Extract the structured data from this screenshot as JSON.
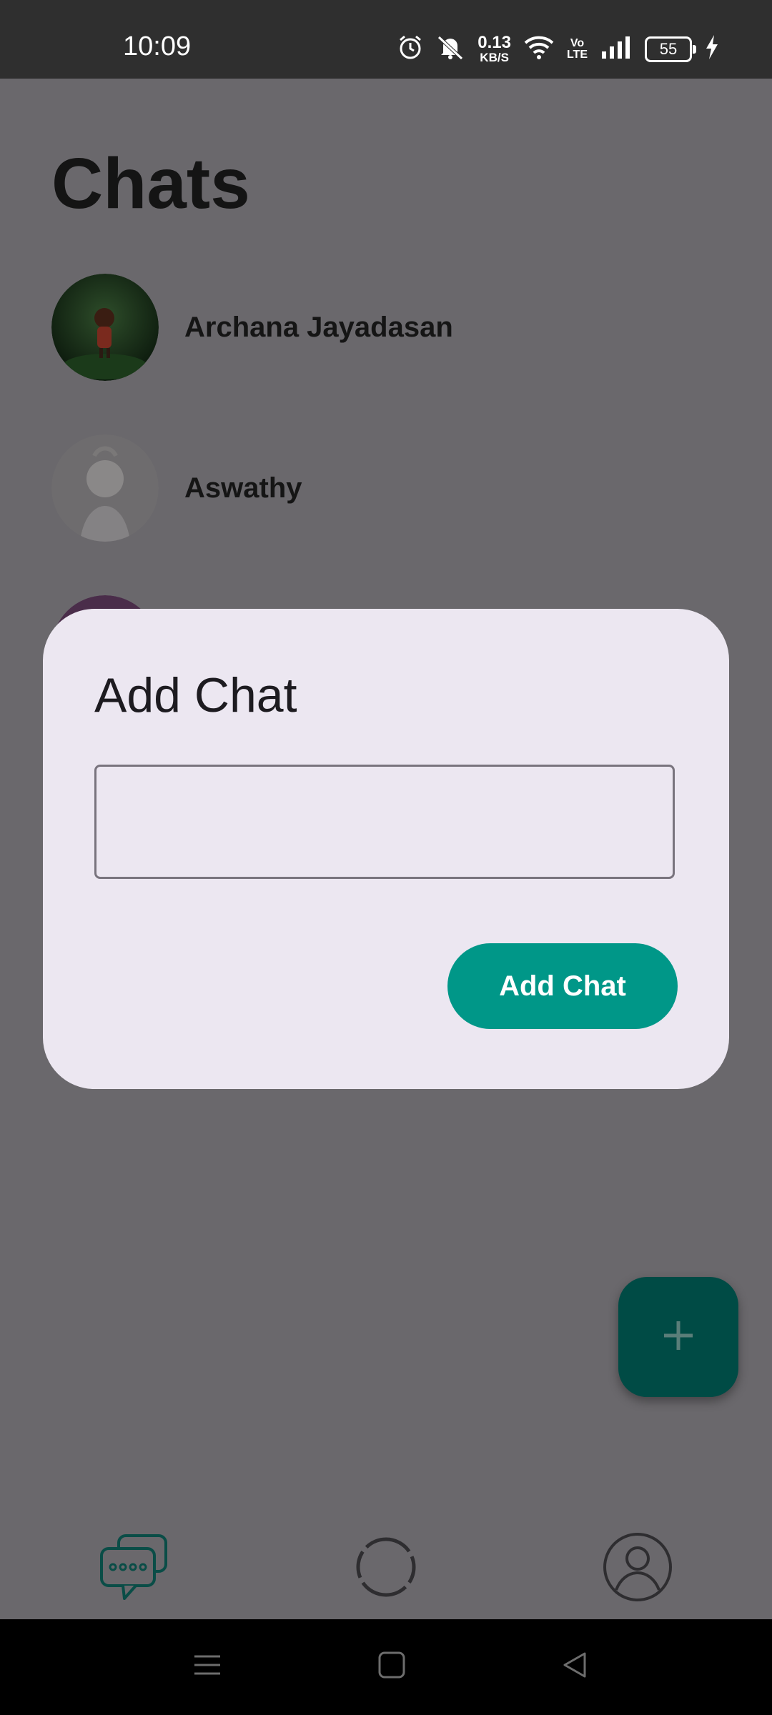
{
  "status_bar": {
    "time": "10:09",
    "net_speed_value": "0.13",
    "net_speed_unit": "KB/S",
    "volte_top": "Vo",
    "volte_bottom": "LTE",
    "battery_level": "55",
    "icons": [
      "alarm-icon",
      "mute-icon",
      "wifi-icon",
      "signal-icon",
      "battery-icon",
      "charging-icon"
    ]
  },
  "page": {
    "title": "Chats"
  },
  "chats": [
    {
      "name": "Archana Jayadasan"
    },
    {
      "name": "Aswathy"
    }
  ],
  "dialog": {
    "title": "Add Chat",
    "input_value": "",
    "input_placeholder": "",
    "button_label": "Add Chat"
  },
  "fab": {
    "icon": "plus-icon"
  },
  "bottom_nav": {
    "items": [
      {
        "icon": "chats-icon",
        "active": true
      },
      {
        "icon": "status-icon",
        "active": false
      },
      {
        "icon": "profile-icon",
        "active": false
      }
    ]
  },
  "system_nav": {
    "items": [
      "menu-icon",
      "home-icon",
      "back-icon"
    ]
  },
  "colors": {
    "accent": "#009788",
    "fab": "#004b45",
    "dialog_bg": "#ece7f1",
    "scrim": "#6a686c"
  }
}
